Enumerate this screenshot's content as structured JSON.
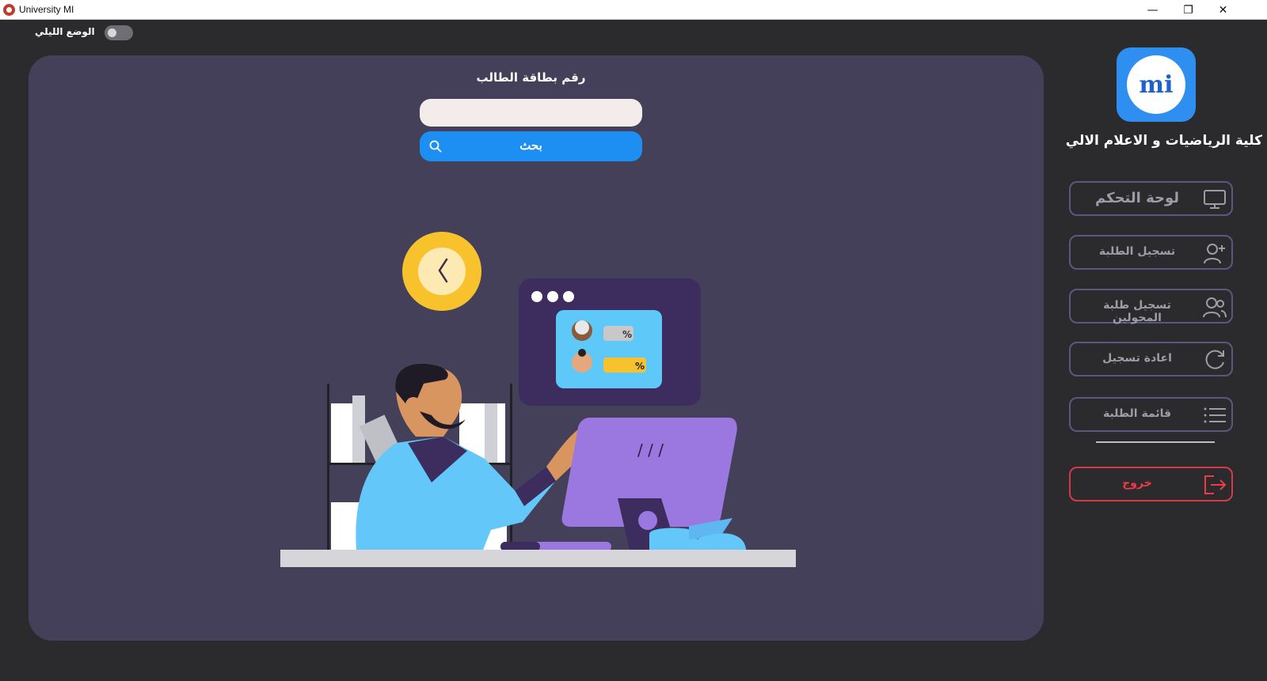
{
  "window": {
    "title": "University MI",
    "minimize_glyph": "—",
    "restore_glyph": "❐",
    "close_glyph": "✕"
  },
  "topbar": {
    "night_mode_label": "الوضع الليلي",
    "night_mode_on": false
  },
  "search": {
    "label": "رقم بطاقة الطالب",
    "input_value": "",
    "button_label": "بحث"
  },
  "sidebar": {
    "logo_text": "mi",
    "faculty_name": "كلية الرياضيات و الاعلام الالي",
    "items": [
      {
        "label": "لوحة التحكم",
        "icon": "monitor-icon"
      },
      {
        "label": "تسجيل الطلبة",
        "icon": "add-user-icon"
      },
      {
        "label": "تسجيل طلبة المحولين",
        "icon": "users-icon"
      },
      {
        "label": "اعادة تسجيل",
        "icon": "refresh-icon"
      },
      {
        "label": "قائمة الطلبة",
        "icon": "list-icon"
      }
    ],
    "exit_label": "خروج",
    "exit_icon": "logout-icon",
    "exit_color": "#f03a4a"
  },
  "illustration": {
    "percent_1": "%",
    "percent_2": "%",
    "monitor_marks": "/ / /"
  },
  "colors": {
    "background": "#2b2b2e",
    "panel": "#45405a",
    "accent": "#1e8ff2"
  }
}
